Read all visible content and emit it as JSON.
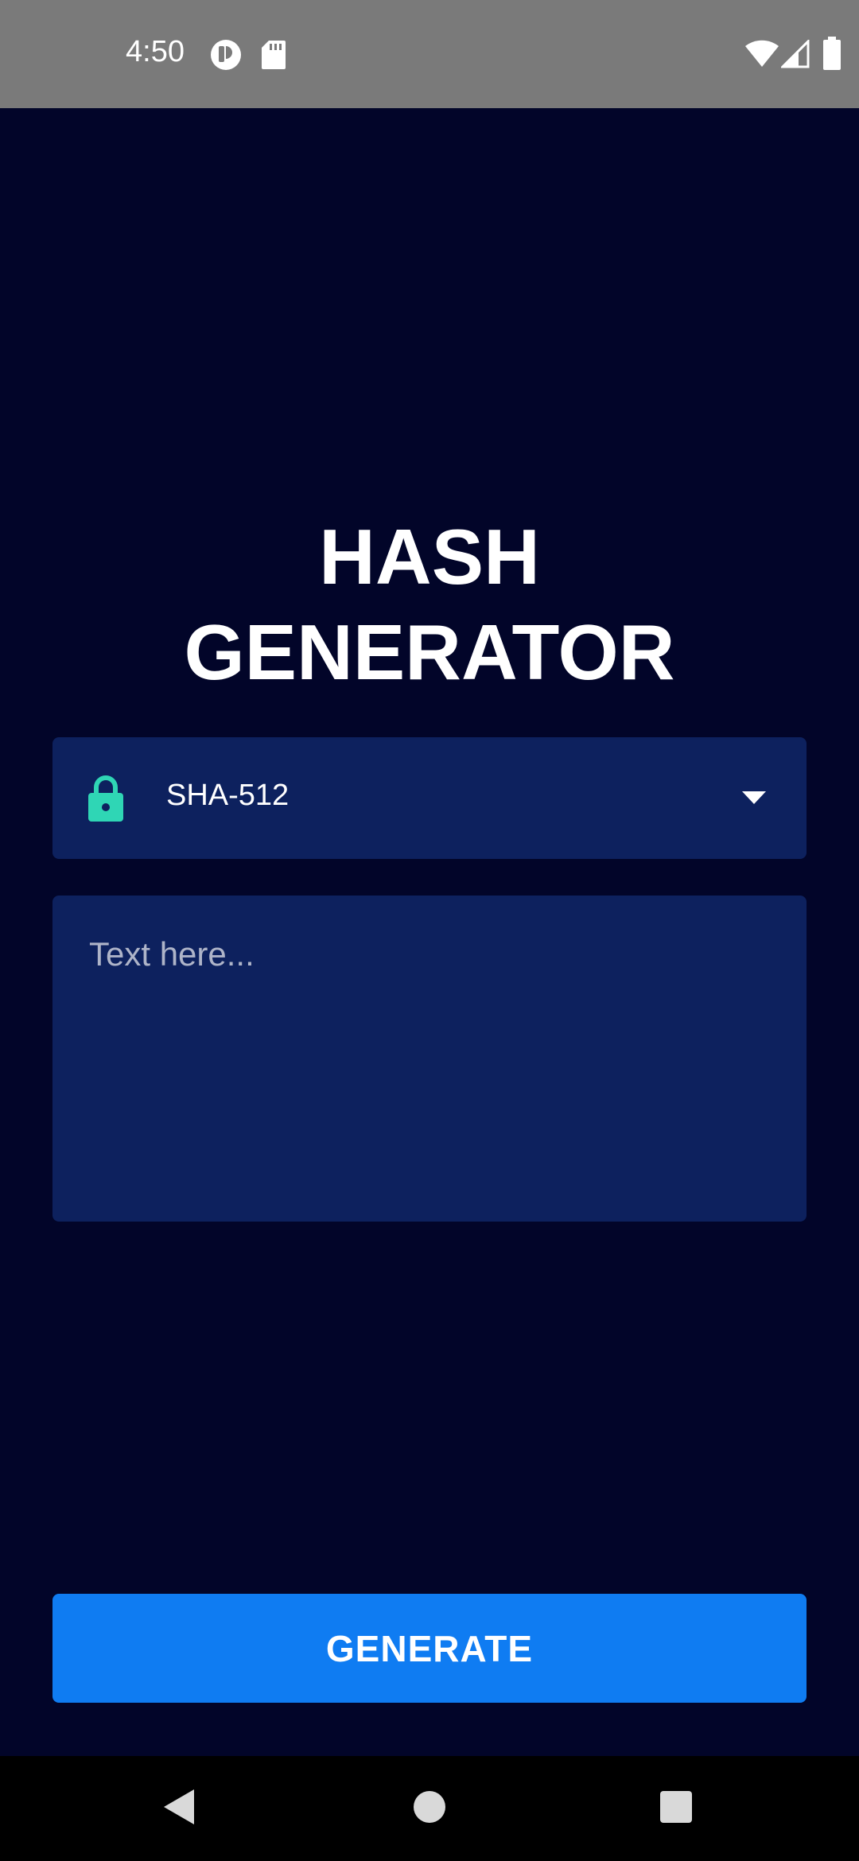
{
  "status_bar": {
    "time": "4:50",
    "icons": [
      "notification-app-icon",
      "sd-card-icon",
      "wifi-icon",
      "signal-icon",
      "battery-icon"
    ]
  },
  "title": {
    "line1": "HASH",
    "line2": "GENERATOR"
  },
  "algorithm_dropdown": {
    "icon": "lock-icon",
    "selected": "SHA-512",
    "accent_color": "#2fd6b5"
  },
  "input": {
    "placeholder": "Text here...",
    "value": ""
  },
  "generate_button": {
    "label": "GENERATE",
    "color": "#0f7cf2"
  },
  "navigation": {
    "buttons": [
      "back-icon",
      "home-icon",
      "recents-icon"
    ]
  },
  "colors": {
    "background": "#020529",
    "field_background": "#0d215e",
    "status_bar": "#7a7a7a"
  }
}
